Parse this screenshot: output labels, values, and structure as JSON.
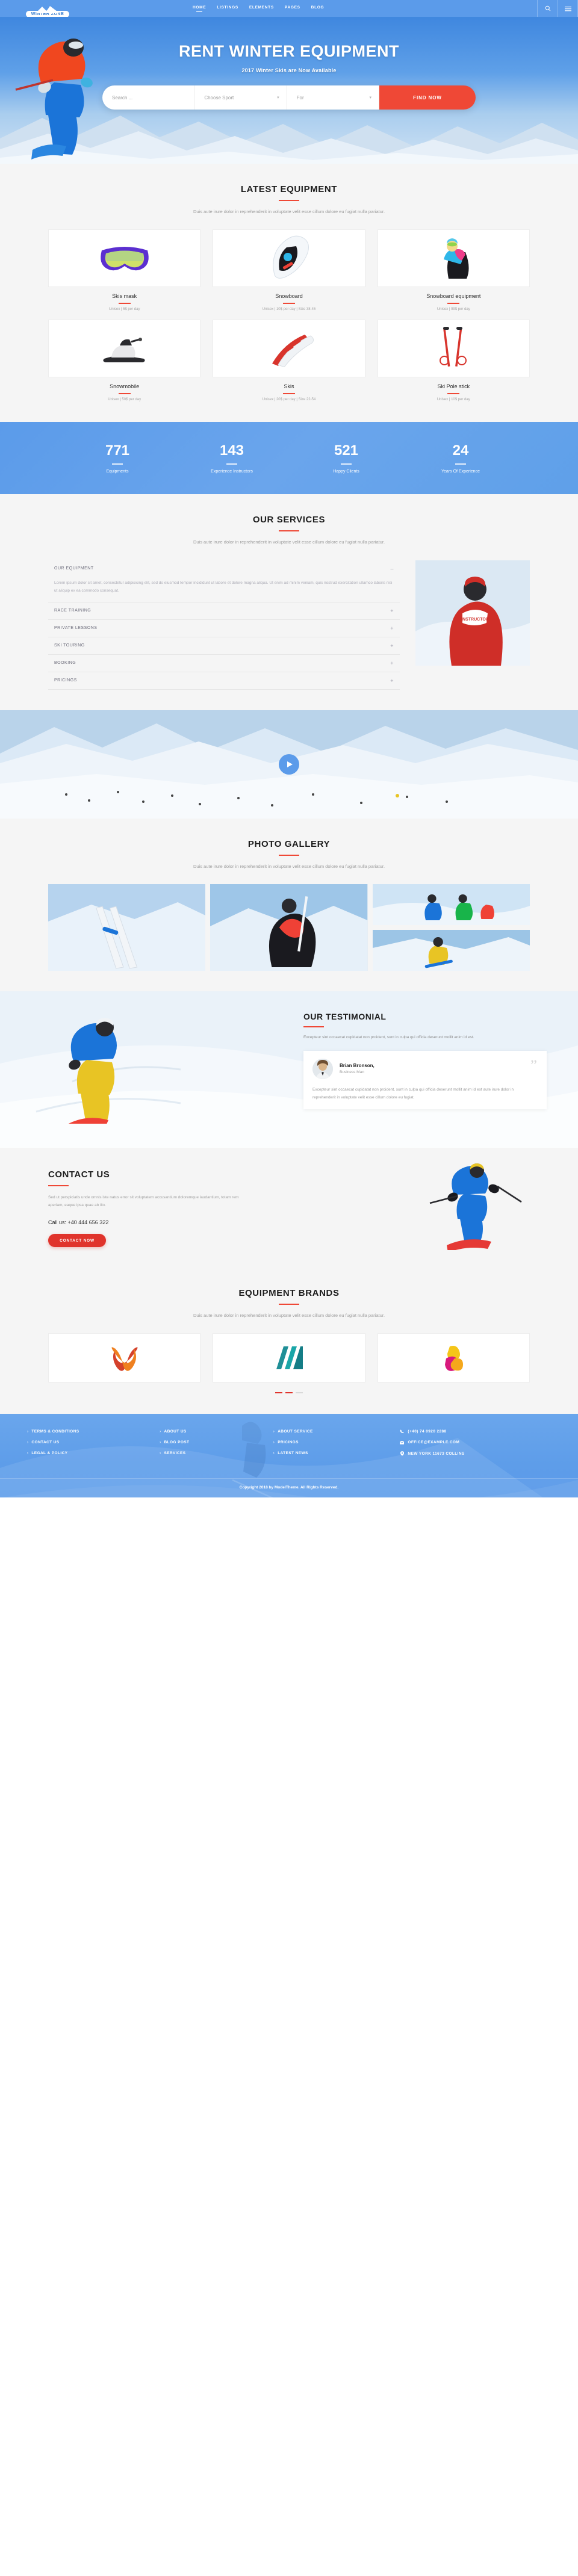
{
  "brand": {
    "name": "WINTER ZONE"
  },
  "nav": {
    "items": [
      {
        "label": "HOME",
        "active": true
      },
      {
        "label": "LISTINGS",
        "active": false
      },
      {
        "label": "ELEMENTS",
        "active": false
      },
      {
        "label": "PAGES",
        "active": false
      },
      {
        "label": "BLOG",
        "active": false
      }
    ],
    "tools": [
      {
        "name": "search-icon"
      },
      {
        "name": "menu-icon"
      }
    ]
  },
  "hero": {
    "title": "RENT WINTER EQUIPMENT",
    "subtitle": "2017 Winter Skis are Now Available",
    "search": {
      "placeholder": "Search ...",
      "value": "",
      "sport_label": "Choose Sport",
      "for_label": "For",
      "button": "FIND NOW"
    }
  },
  "equipment": {
    "title": "LATEST EQUIPMENT",
    "desc": "Duis aute irure dolor in reprehenderit in voluptate velit esse cillum dolore eu fugiat nulla pariatur.",
    "items": [
      {
        "name": "Skis mask",
        "meta": "Unisex | 5$ per day",
        "icon": "ski-goggles-icon"
      },
      {
        "name": "Snowboard",
        "meta": "Unisex | 10$ per day | Size 38-45",
        "icon": "snowboard-icon"
      },
      {
        "name": "Snowboard equipment",
        "meta": "Unisex | 99$ per day",
        "icon": "snowboarder-icon"
      },
      {
        "name": "Snowmobile",
        "meta": "Unisex | 50$ per day",
        "icon": "snowmobile-icon"
      },
      {
        "name": "Skis",
        "meta": "Unisex | 20$ per day | Size 22-54",
        "icon": "skis-icon"
      },
      {
        "name": "Ski Pole stick",
        "meta": "Unisex | 10$ per day",
        "icon": "ski-poles-icon"
      }
    ]
  },
  "stats": [
    {
      "value": "771",
      "label": "Equipments"
    },
    {
      "value": "143",
      "label": "Experience Instructors"
    },
    {
      "value": "521",
      "label": "Happy Clients"
    },
    {
      "value": "24",
      "label": "Years Of Experience"
    }
  ],
  "services": {
    "title": "OUR SERVICES",
    "desc": "Duis aute irure dolor in reprehenderit in voluptate velit esse cillum dolore eu fugiat nulla pariatur.",
    "items": [
      {
        "label": "OUR EQUIPMENT",
        "open": true,
        "sign": "–",
        "body": "Lorem ipsum dolor sit amet, consectetur adipisicing elit, sed do eiusmod tempor incididunt ut labore et dolore magna aliqua. Ut enim ad minim veniam, quis nostrud exercitation ullamco laboris nisi ut aliquip ex ea commodo consequat."
      },
      {
        "label": "RACE TRAINING",
        "open": false,
        "sign": "+"
      },
      {
        "label": "PRIVATE LESSONS",
        "open": false,
        "sign": "+"
      },
      {
        "label": "SKI TOURING",
        "open": false,
        "sign": "+"
      },
      {
        "label": "BOOKING",
        "open": false,
        "sign": "+"
      },
      {
        "label": "PRICINGS",
        "open": false,
        "sign": "+"
      }
    ]
  },
  "video": {
    "play_label": "play-button"
  },
  "gallery": {
    "title": "PHOTO GALLERY",
    "desc": "Duis aute irure dolor in reprehenderit in voluptate velit esse cillum dolore eu fugiat nulla pariatur."
  },
  "testimonial": {
    "title": "OUR TESTIMONIAL",
    "lead": "Excepteur sint occaecat cupidatat non proident, sunt in culpa qui officia deserunt mollit anim id est.",
    "name": "Brian Bronson,",
    "role": "Business Man",
    "quote": "Excepteur sint occaecat cupidatat non proident, sunt in culpa qui officia deserunt mollit anim id est aute irure dolor in reprehenderit in voluptate velit esse cillum dolore eu fugiat."
  },
  "contact": {
    "title": "CONTACT US",
    "desc": "Sed ut perspiciatis unde omnis iste natus error sit voluptatem accusantium doloremque laudantium, totam rem aperiam, eaque ipsa quae ab illo.",
    "call": "Call us: +40 444 656 322",
    "button": "CONTACT NOW"
  },
  "brands": {
    "title": "EQUIPMENT BRANDS",
    "desc": "Duis aute irure dolor in reprehenderit in voluptate velit esse cillum dolore eu fugiat nulla pariatur.",
    "logos": [
      "brand-logo-infinity",
      "brand-logo-m",
      "brand-logo-ribbon"
    ],
    "dots": [
      "active",
      "active",
      "inactive"
    ]
  },
  "footer": {
    "columns": [
      {
        "links": [
          "TERMS & CONDITIONS",
          "CONTACT US",
          "LEGAL & POLICY"
        ]
      },
      {
        "links": [
          "ABOUT US",
          "BLOG POST",
          "SERVICES"
        ]
      },
      {
        "links": [
          "ABOUT SERVICE",
          "PRICINGS",
          "LATEST NEWS"
        ]
      }
    ],
    "contact": [
      {
        "icon": "phone-icon",
        "text": "(+40) 74 0920 2288"
      },
      {
        "icon": "mail-icon",
        "text": "OFFICE@EXAMPLE.COM"
      },
      {
        "icon": "pin-icon",
        "text": "NEW YORK 11673 COLLINS"
      }
    ],
    "copyright": "Copyright 2018 by ModelTheme. All Rights Reserved."
  }
}
